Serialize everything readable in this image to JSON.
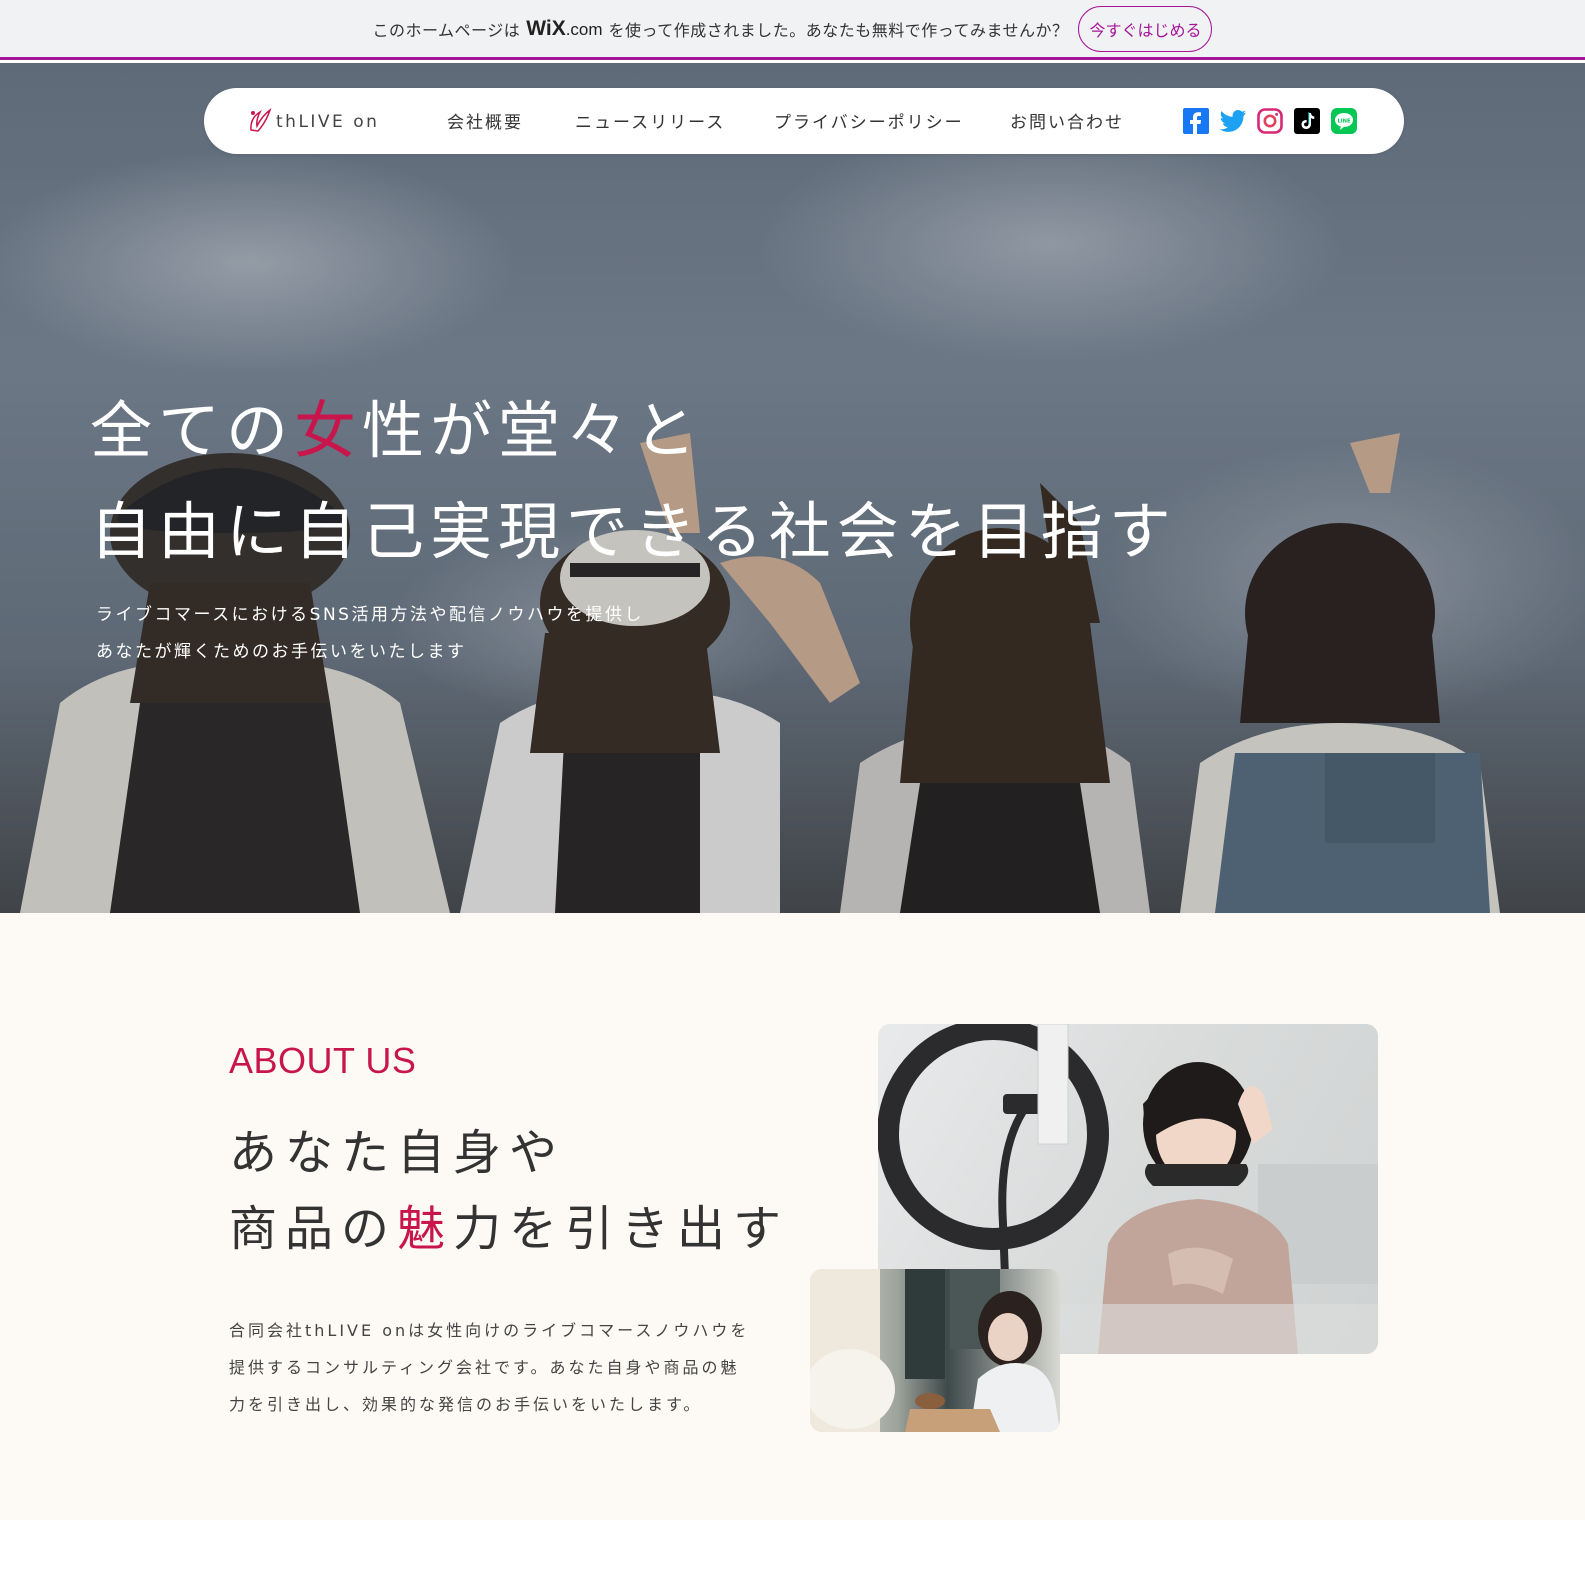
{
  "wix_banner": {
    "text_before": "このホームページは",
    "logo_main": "WiX",
    "logo_suffix": ".com",
    "text_after": "を使って作成されました。あなたも無料で作ってみませんか？",
    "cta_label": "今すぐはじめる"
  },
  "nav": {
    "logo_text": "thLIVE on",
    "items": [
      {
        "label": "会社概要"
      },
      {
        "label": "ニュースリリース"
      },
      {
        "label": "プライバシーポリシー"
      },
      {
        "label": "お問い合わせ"
      }
    ],
    "social": [
      {
        "name": "facebook-icon",
        "color": "#1877f2"
      },
      {
        "name": "twitter-icon",
        "color": "#1da1f2"
      },
      {
        "name": "instagram-icon",
        "color": "#d62976"
      },
      {
        "name": "tiktok-icon",
        "color": "#000000"
      },
      {
        "name": "line-icon",
        "color": "#06c755"
      }
    ]
  },
  "hero": {
    "title_line1_before": "全ての",
    "title_line1_accent": "女",
    "title_line1_after": "性が堂々と",
    "title_line2": "自由に自己実現できる社会を目指す",
    "subtitle_line1": "ライブコマースにおけるSNS活用方法や配信ノウハウを提供し",
    "subtitle_line2": "あなたが輝くためのお手伝いをいたします"
  },
  "about": {
    "label": "ABOUT US",
    "heading_line1": "あなた自身や",
    "heading_line2_before": "商品の",
    "heading_line2_accent": "魅",
    "heading_line2_after": "力を引き出す",
    "body_line1": "合同会社thLIVE onは女性向けのライブコマースノウハウを",
    "body_line2": "提供するコンサルティング会社です。あなた自身や商品の魅",
    "body_line3": "力を引き出し、効果的な発信のお手伝いをいたします。"
  },
  "colors": {
    "accent": "#c8154b",
    "wix_purple": "#a5159a",
    "about_bg": "#fdfaf5"
  }
}
